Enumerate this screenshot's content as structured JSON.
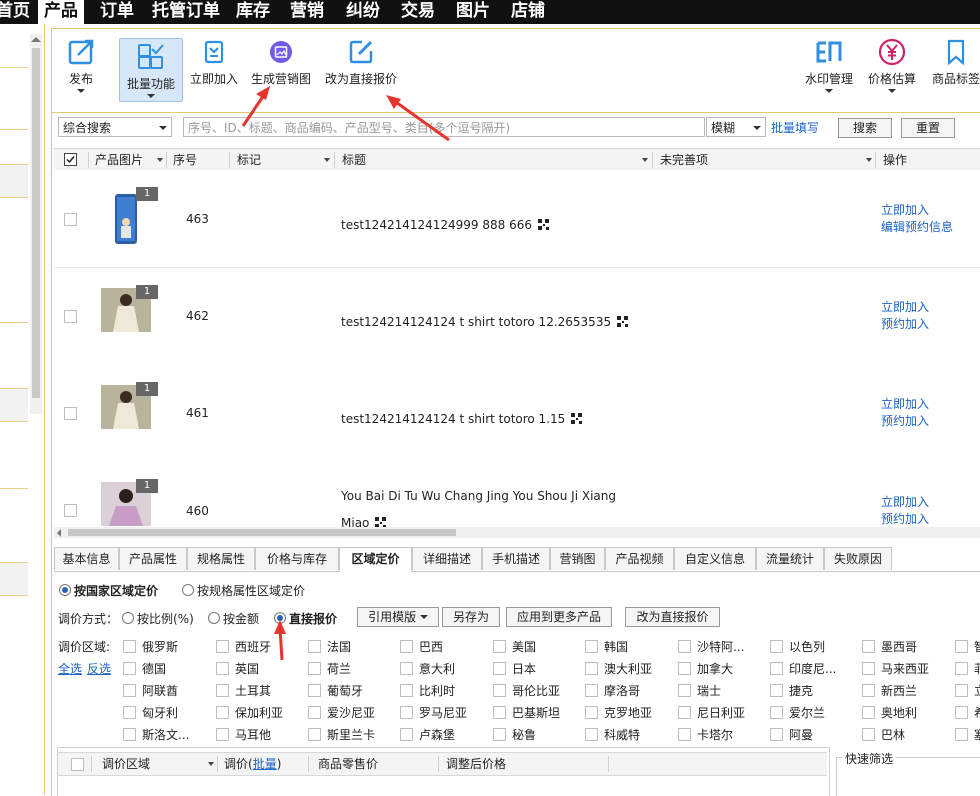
{
  "nav": {
    "items": [
      "首页",
      "产品",
      "订单",
      "托管订单",
      "库存",
      "营销",
      "纠纷",
      "交易",
      "图片",
      "店铺"
    ],
    "active_index": 1
  },
  "toolbar": {
    "publish": "发布",
    "batch": "批量功能",
    "add_now": "立即加入",
    "gen_marketing": "生成营销图",
    "direct_quote": "改为直接报价",
    "watermark": "水印管理",
    "price_estimate": "价格估算",
    "product_tag": "商品标签"
  },
  "search": {
    "type": "综合搜索",
    "placeholder": "序号、ID、标题、商品编码、产品型号、类目(多个逗号隔开)",
    "mode": "模糊",
    "batch_fill": "批量填写",
    "search_btn": "搜索",
    "reset_btn": "重置"
  },
  "grid": {
    "headers": {
      "image": "产品图片",
      "seq": "序号",
      "mark": "标记",
      "title": "标题",
      "incomplete": "未完善项",
      "ops": "操作"
    },
    "rows": [
      {
        "badge": "1",
        "seq": "463",
        "title": "test124214124124999 888 666",
        "ops": [
          "立即加入",
          "编辑预约信息"
        ]
      },
      {
        "badge": "1",
        "seq": "462",
        "title": "test124214124124 t shirt totoro 12.2653535",
        "ops": [
          "立即加入",
          "预约加入"
        ]
      },
      {
        "badge": "1",
        "seq": "461",
        "title": "test124214124124 t shirt totoro 1.15",
        "ops": [
          "立即加入",
          "预约加入"
        ]
      },
      {
        "badge": "1",
        "seq": "460",
        "title": "You Bai Di Tu Wu Chang Jing You Shou Ji Xiang",
        "title2": "Miao",
        "ops": [
          "立即加入",
          "预约加入"
        ]
      }
    ]
  },
  "tabs": [
    "基本信息",
    "产品属性",
    "规格属性",
    "价格与库存",
    "区域定价",
    "详细描述",
    "手机描述",
    "营销图",
    "产品视频",
    "自定义信息",
    "流量统计",
    "失败原因"
  ],
  "active_tab": 4,
  "pricing": {
    "by_country": "按国家区域定价",
    "by_spec": "按规格属性区域定价",
    "method_label": "调价方式：",
    "by_ratio": "按比例(%)",
    "by_amount": "按金额",
    "direct": "直接报价",
    "template_btn": "引用模版",
    "save_as_btn": "另存为",
    "apply_more_btn": "应用到更多产品",
    "direct_btn": "改为直接报价",
    "region_label": "调价区域:",
    "select_all": "全选",
    "invert": "反选",
    "regions": [
      [
        "俄罗斯",
        "西班牙",
        "法国",
        "巴西",
        "美国",
        "韩国",
        "沙特阿...",
        "以色列",
        "墨西哥",
        "智"
      ],
      [
        "德国",
        "英国",
        "荷兰",
        "意大利",
        "日本",
        "澳大利亚",
        "加拿大",
        "印度尼...",
        "马来西亚",
        "菲"
      ],
      [
        "阿联酋",
        "土耳其",
        "葡萄牙",
        "比利时",
        "哥伦比亚",
        "摩洛哥",
        "瑞士",
        "捷克",
        "新西兰",
        "立"
      ],
      [
        "匈牙利",
        "保加利亚",
        "爱沙尼亚",
        "罗马尼亚",
        "巴基斯坦",
        "克罗地亚",
        "尼日利亚",
        "爱尔兰",
        "奥地利",
        "希"
      ],
      [
        "斯洛文...",
        "马耳他",
        "斯里兰卡",
        "卢森堡",
        "秘鲁",
        "科威特",
        "卡塔尔",
        "阿曼",
        "巴林",
        "塞"
      ]
    ]
  },
  "bottom_table": {
    "region": "调价区域",
    "adjust": "调价(",
    "batch": "批量",
    "adjust_end": ")",
    "retail": "商品零售价",
    "after": "调整后价格",
    "quick_filter": "快速筛选"
  },
  "colors": {
    "accent_blue": "#2f8fe0",
    "link_blue": "#1a62c9",
    "pink": "#d0226a",
    "purple": "#6e5ce6",
    "arrow_red": "#e8332c",
    "frame_gold": "#e6c870"
  },
  "icons": {
    "publish": "edit-box-icon",
    "batch": "grid-check-icon",
    "add_now": "save-icon",
    "gen_marketing": "image-icon",
    "direct_quote": "pencil-icon",
    "watermark": "watermark-icon",
    "price_estimate": "yen-icon",
    "product_tag": "bookmark-icon"
  }
}
